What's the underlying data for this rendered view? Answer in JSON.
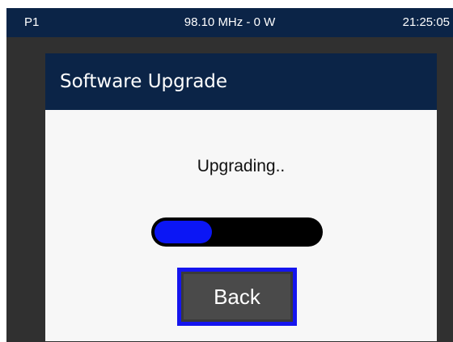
{
  "status_bar": {
    "preset": "P1",
    "frequency_power": "98.10 MHz - 0 W",
    "clock": "21:25:05"
  },
  "dialog": {
    "title": "Software Upgrade",
    "message": "Upgrading..",
    "progress": 0.35,
    "back_label": "Back"
  },
  "colors": {
    "header_background": "#0b2447",
    "progress_fill": "#0b16f5",
    "button_focus_border": "#1515ee"
  }
}
